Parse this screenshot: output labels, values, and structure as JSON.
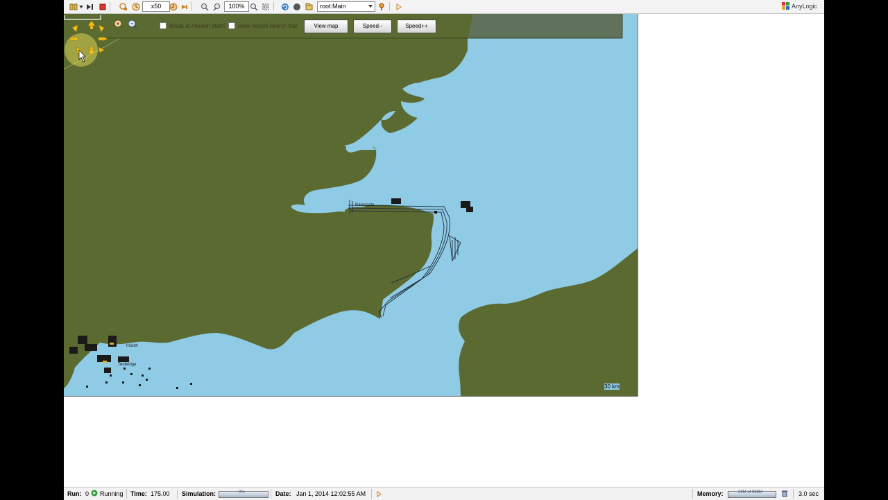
{
  "toolbar": {
    "speed": "x50",
    "zoom": "100%",
    "navigation": "root:Main",
    "brand": "AnyLogic"
  },
  "map": {
    "checkboxes": [
      {
        "label": "Break at mission start?",
        "checked": false
      },
      {
        "label": "eave Vessel Search trail",
        "checked": false
      }
    ],
    "buttons": {
      "view_map": "View map",
      "speed_down": "Speed--",
      "speed_up": "Speed++"
    },
    "scale_label": "30 km",
    "place_labels": [
      "Ramsgate",
      "Tenbridge",
      "mouth"
    ]
  },
  "status": {
    "run_label": "Run:",
    "run_value": "0",
    "run_state": "Running",
    "time_label": "Time:",
    "time_value": "175.00",
    "simulation_label": "Simulation:",
    "simulation_bar_text": "0%",
    "date_label": "Date:",
    "date_value": "Jan 1, 2014 12:02:55 AM",
    "memory_label": "Memory:",
    "memory_bar_text": "29M of 989M",
    "elapsed": "3.0 sec"
  },
  "colors": {
    "land": "#5b6a30",
    "sea": "#8fcbe5",
    "toolbar": "#f3f3f3"
  },
  "icons": [
    "run-icon",
    "step-icon",
    "stop-icon",
    "speed-down-icon",
    "speed-up-icon",
    "zoom-in-icon",
    "zoom-out-icon",
    "fit-icon",
    "refresh-icon",
    "navigation-dropdown-icon",
    "pan-arrows-icon",
    "trash-icon"
  ]
}
